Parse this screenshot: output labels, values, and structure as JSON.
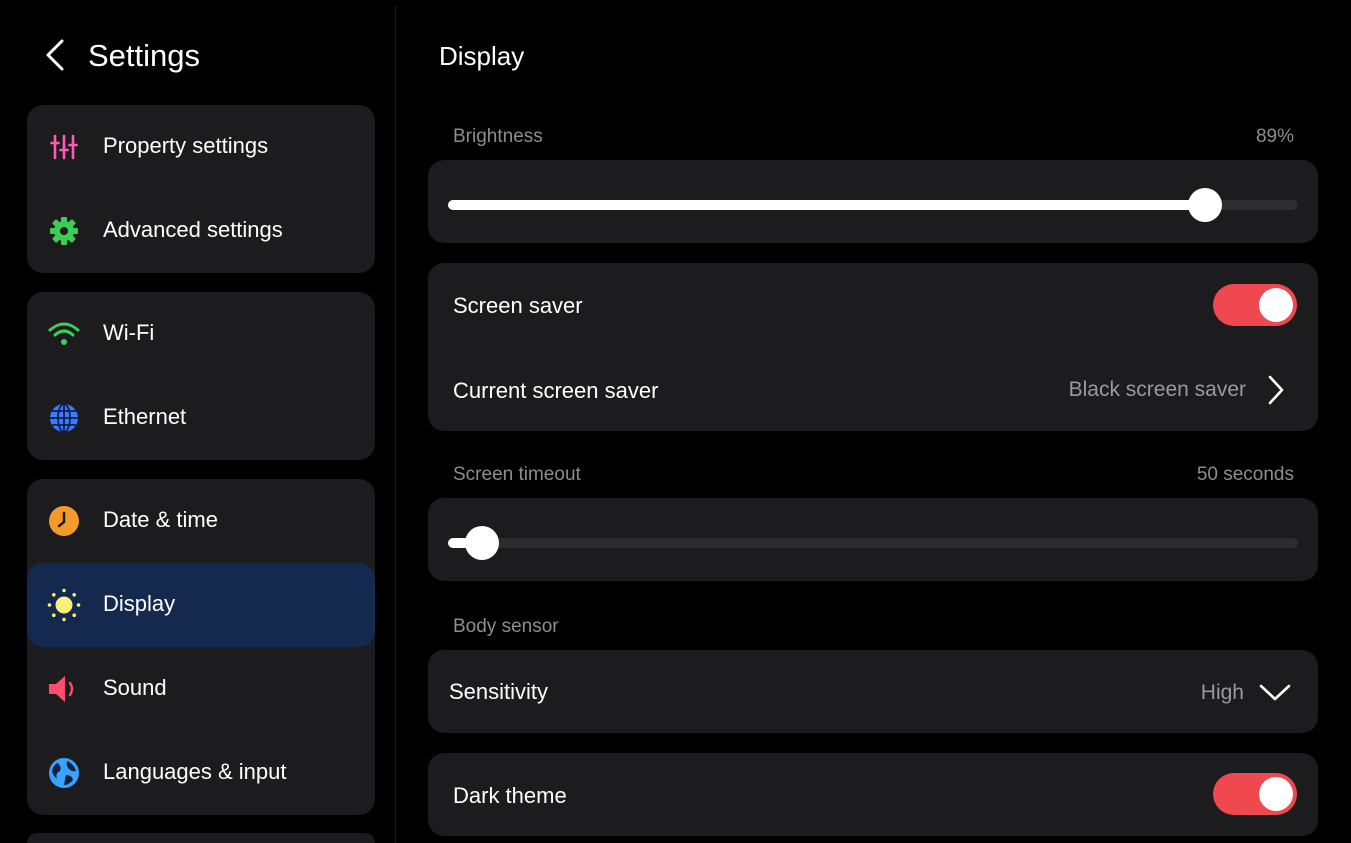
{
  "sidebar": {
    "title": "Settings",
    "items": [
      {
        "label": "Property settings",
        "icon": "sliders-icon",
        "color": "#ff5ab4"
      },
      {
        "label": "Advanced settings",
        "icon": "gear-icon",
        "color": "#3dcc55"
      },
      {
        "label": "Wi-Fi",
        "icon": "wifi-icon",
        "color": "#3dcc55"
      },
      {
        "label": "Ethernet",
        "icon": "globe-grid-icon",
        "color": "#3b7bff"
      },
      {
        "label": "Date & time",
        "icon": "clock-icon",
        "color": "#f39a2b"
      },
      {
        "label": "Display",
        "icon": "sun-icon",
        "color": "#f6f07a",
        "active": true
      },
      {
        "label": "Sound",
        "icon": "speaker-icon",
        "color": "#ff4d6b"
      },
      {
        "label": "Languages & input",
        "icon": "earth-icon",
        "color": "#3aa1ff"
      }
    ]
  },
  "main": {
    "title": "Display",
    "brightness": {
      "label": "Brightness",
      "value_text": "89%",
      "value": 0.89
    },
    "screen_saver": {
      "label": "Screen saver",
      "enabled": true
    },
    "current_screen_saver": {
      "label": "Current screen saver",
      "value": "Black screen saver"
    },
    "screen_timeout": {
      "label": "Screen timeout",
      "value_text": "50 seconds",
      "fraction": 0.04
    },
    "body_sensor": {
      "section_label": "Body sensor",
      "sensitivity_label": "Sensitivity",
      "sensitivity_value": "High"
    },
    "dark_theme": {
      "label": "Dark theme",
      "enabled": true
    }
  },
  "colors": {
    "accent_toggle": "#f0484f",
    "active_item": "#14294d",
    "card": "#1c1c1e"
  }
}
